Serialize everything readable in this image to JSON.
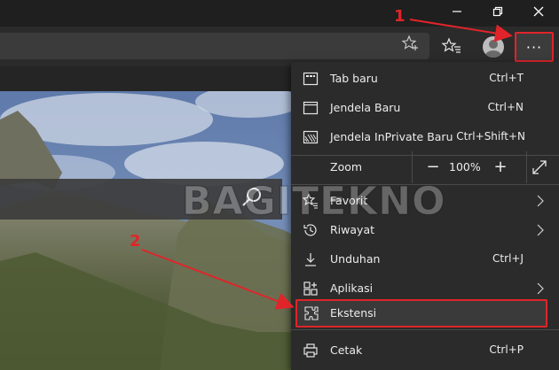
{
  "window": {
    "minimize_icon": "minimize-icon",
    "maximize_icon": "restore-icon",
    "close_icon": "close-icon"
  },
  "toolbar": {
    "add_favorite_icon": "star-plus-icon",
    "favorites_icon": "favorites-list-icon",
    "profile_icon": "profile-avatar-icon",
    "more_label": "···"
  },
  "menu": {
    "items_top": [
      {
        "label": "Tab baru",
        "shortcut": "Ctrl+T",
        "icon": "new-tab-icon"
      },
      {
        "label": "Jendela Baru",
        "shortcut": "Ctrl+N",
        "icon": "new-window-icon"
      },
      {
        "label": "Jendela InPrivate Baru",
        "shortcut": "Ctrl+Shift+N",
        "icon": "inprivate-window-icon"
      }
    ],
    "zoom": {
      "label": "Zoom",
      "value": "100%",
      "minus": "−",
      "plus": "+"
    },
    "items_mid": [
      {
        "label": "Favorit",
        "icon": "favorites-icon",
        "submenu": true
      },
      {
        "label": "Riwayat",
        "icon": "history-icon",
        "submenu": true
      },
      {
        "label": "Unduhan",
        "shortcut": "Ctrl+J",
        "icon": "download-icon"
      },
      {
        "label": "Aplikasi",
        "icon": "apps-icon",
        "submenu": true
      },
      {
        "label": "Ekstensi",
        "icon": "extensions-icon"
      }
    ],
    "items_bottom": [
      {
        "label": "Cetak",
        "shortcut": "Ctrl+P",
        "icon": "print-icon"
      }
    ]
  },
  "annotations": {
    "step1": "1",
    "step2": "2"
  },
  "watermark": "BAGITEKNO",
  "colors": {
    "highlight": "#e0242a",
    "menu_bg": "#2b2b2b",
    "toolbar_bg": "#2b2b2b"
  }
}
